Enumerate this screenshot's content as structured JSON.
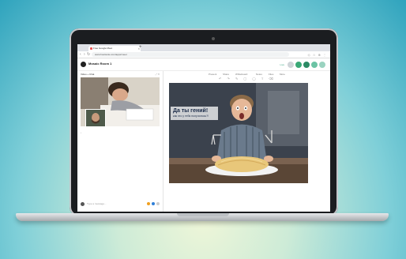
{
  "browser": {
    "tab_title": "Free Google Meet",
    "url": "www.hootsuite.com/apps/meet",
    "ext_icons": "◇ ☆ ⊕ ⋮"
  },
  "app": {
    "title": "Mosaic Room 1",
    "status_label": "Live"
  },
  "left_panel": {
    "header": "Video + Chat",
    "header_icons": "⤢ ✕",
    "chat_placeholder": "Type a message..."
  },
  "right_panel": {
    "toolbar": [
      "Present",
      "Share",
      "Whiteboard",
      "Notes",
      "Files",
      "More"
    ],
    "tools_row": "↶ ↷ ✎ ▢ ◯ T ⌫",
    "slide": {
      "headline": "Да ты гений!",
      "subtext": "как это у тебя получилось?!"
    }
  },
  "colors": {
    "accent_green": "#3aa876",
    "accent_orange": "#f0a020",
    "accent_blue": "#2f7fd8"
  }
}
